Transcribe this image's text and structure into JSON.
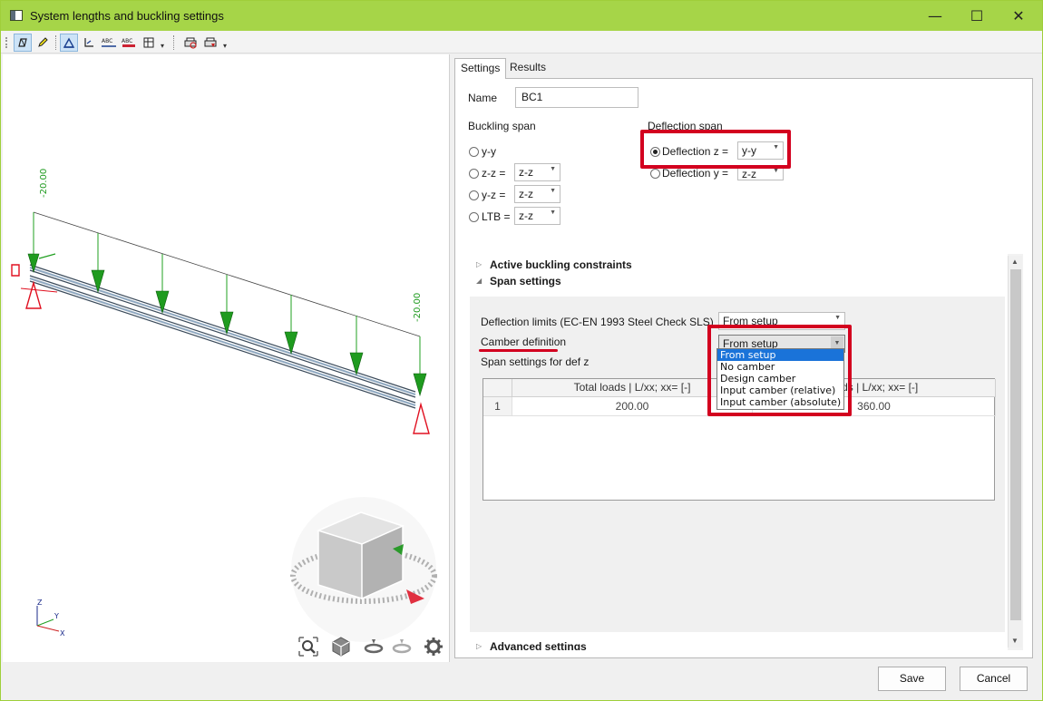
{
  "window": {
    "title": "System lengths and buckling settings",
    "minimize": "—",
    "maximize": "☐",
    "close": "✕"
  },
  "toolbar": {
    "icons": [
      "isometric-view-icon",
      "pencil-icon",
      "select-icon",
      "axis-icon",
      "abc-label-icon",
      "abc-label-2-icon",
      "table-icon",
      "print-icon",
      "export-icon"
    ]
  },
  "viewport": {
    "load_label_left": "-20.00",
    "load_label_right": "-20.00",
    "axis_z": "Z",
    "axis_y": "Y",
    "axis_x": "X"
  },
  "tabs": [
    {
      "label": "Settings",
      "active": true
    },
    {
      "label": "Results",
      "active": false
    }
  ],
  "settings": {
    "name_label": "Name",
    "name_value": "BC1",
    "buckling_span_label": "Buckling span",
    "buckling": [
      {
        "label": "y-y",
        "combo": null
      },
      {
        "label": "z-z =",
        "combo": "z-z"
      },
      {
        "label": "y-z =",
        "combo": "z-z"
      },
      {
        "label": "LTB =",
        "combo": "z-z"
      }
    ],
    "deflection_span_label": "Deflection span",
    "deflection": [
      {
        "label": "Deflection z =",
        "combo": "y-y",
        "checked": true
      },
      {
        "label": "Deflection y =",
        "combo": "z-z",
        "checked": false
      }
    ]
  },
  "sections": {
    "active_buckling": "Active buckling constraints",
    "span_settings": "Span settings",
    "advanced": "Advanced settings"
  },
  "span": {
    "deflection_limits_label": "Deflection limits (EC-EN 1993 Steel Check SLS)",
    "deflection_limits_value": "From setup",
    "camber_label": "Camber definition",
    "camber_value": "From setup",
    "span_def_label": "Span settings for def z",
    "dropdown_options": [
      "From setup",
      "No camber",
      "Design camber",
      "Input camber (relative)",
      "Input camber (absolute)"
    ],
    "grid": {
      "headers": [
        "Total loads | L/xx; xx= [-]",
        "oads | L/xx; xx= [-]"
      ],
      "rows": [
        {
          "index": "1",
          "values": [
            "200.00",
            "360.00"
          ]
        }
      ]
    }
  },
  "buttons": {
    "save": "Save",
    "cancel": "Cancel"
  },
  "colors": {
    "titlebar": "#a6d548",
    "highlight_red": "#d3001f",
    "selection_blue": "#1a73d9",
    "load_green": "#22a022",
    "support_red": "#e01020"
  }
}
